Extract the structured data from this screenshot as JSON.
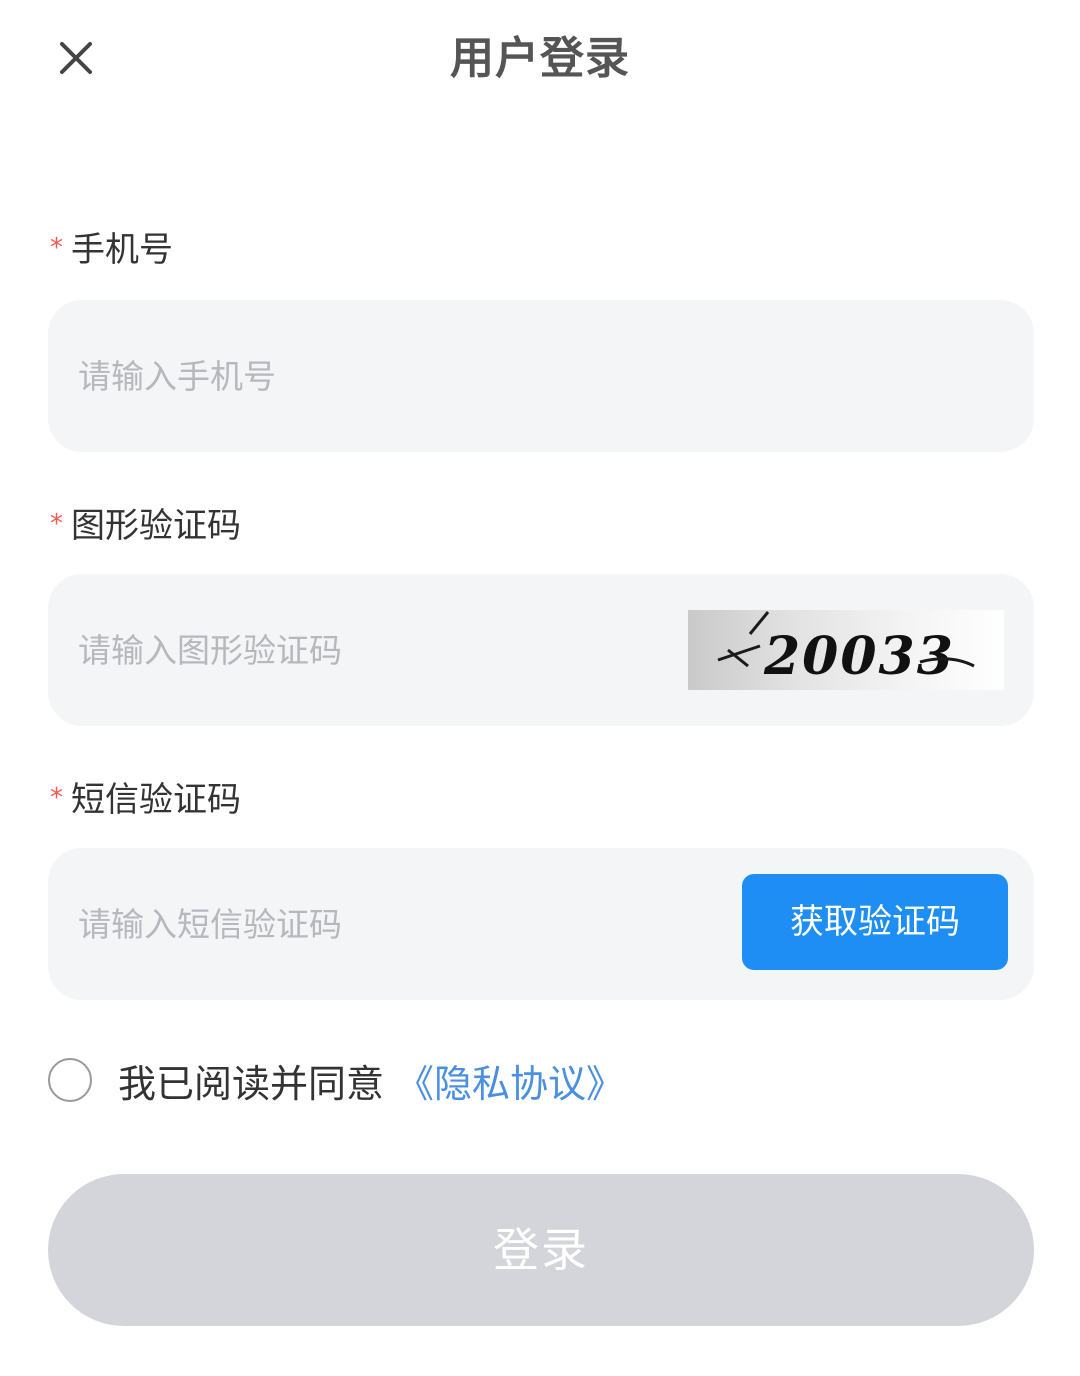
{
  "header": {
    "title": "用户登录",
    "close_icon": "close-icon"
  },
  "form": {
    "phone": {
      "required_mark": "*",
      "label": "手机号",
      "placeholder": "请输入手机号",
      "value": ""
    },
    "captcha": {
      "required_mark": "*",
      "label": "图形验证码",
      "placeholder": "请输入图形验证码",
      "value": "",
      "image_text": "20033"
    },
    "sms": {
      "required_mark": "*",
      "label": "短信验证码",
      "placeholder": "请输入短信验证码",
      "value": "",
      "button_label": "获取验证码"
    }
  },
  "agreement": {
    "checked": false,
    "text": "我已阅读并同意",
    "link_label": "《隐私协议》"
  },
  "login_button": {
    "label": "登录",
    "enabled": false
  },
  "colors": {
    "accent": "#1e8ef5",
    "link": "#4b8fe0",
    "required": "#f05a50",
    "input_bg": "#f4f5f6",
    "disabled_button": "#d3d5da"
  }
}
